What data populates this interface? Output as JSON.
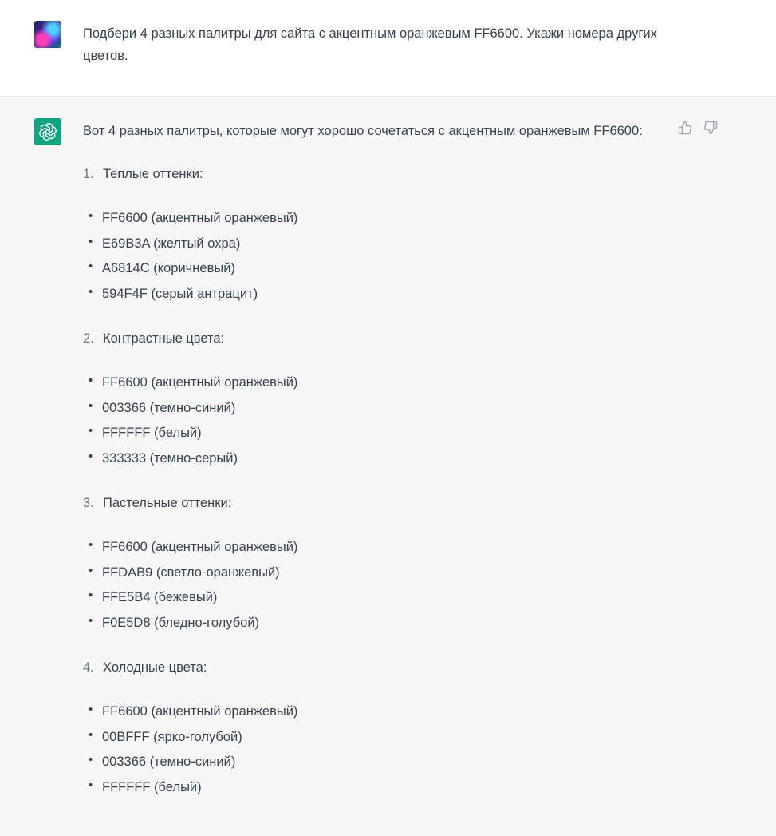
{
  "user_message": {
    "text": "Подбери 4 разных палитры для сайта с акцентным оранжевым FF6600. Укажи номера других цветов."
  },
  "assistant_message": {
    "intro": "Вот 4 разных палитры, которые могут хорошо сочетаться с акцентным оранжевым FF6600:",
    "sections": [
      {
        "number": "1.",
        "title": "Теплые оттенки:",
        "items": [
          "FF6600 (акцентный оранжевый)",
          "E69B3A (желтый охра)",
          "A6814C (коричневый)",
          "594F4F (серый антрацит)"
        ]
      },
      {
        "number": "2.",
        "title": "Контрастные цвета:",
        "items": [
          "FF6600 (акцентный оранжевый)",
          "003366 (темно-синий)",
          "FFFFFF (белый)",
          "333333 (темно-серый)"
        ]
      },
      {
        "number": "3.",
        "title": "Пастельные оттенки:",
        "items": [
          "FF6600 (акцентный оранжевый)",
          "FFDAB9 (светло-оранжевый)",
          "FFE5B4 (бежевый)",
          "F0E5D8 (бледно-голубой)"
        ]
      },
      {
        "number": "4.",
        "title": "Холодные цвета:",
        "items": [
          "FF6600 (акцентный оранжевый)",
          "00BFFF (ярко-голубой)",
          "003366 (темно-синий)",
          "FFFFFF (белый)"
        ]
      }
    ],
    "feedback_icons": [
      "thumbs-up-icon",
      "thumbs-down-icon"
    ]
  },
  "colors": {
    "assistant_avatar": "#10a37f",
    "assistant_bg": "#f7f7f8",
    "user_bg": "#ffffff",
    "text": "#374151"
  }
}
